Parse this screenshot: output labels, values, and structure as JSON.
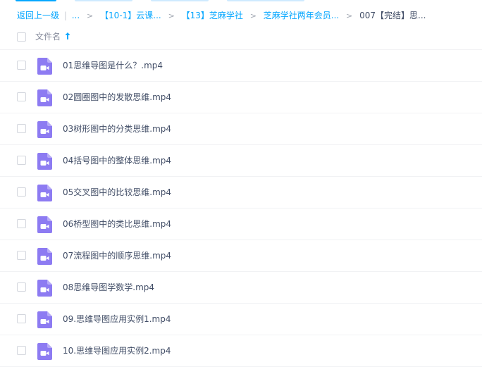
{
  "colors": {
    "accent": "#06a7ff",
    "video_icon": "#8d7bf2",
    "text": "#424e67",
    "muted": "#878c9c"
  },
  "breadcrumb": {
    "back": "返回上一级",
    "ellipsis": "...",
    "separator": "|",
    "chevron": ">",
    "items": [
      "【10-1】云课...",
      "【13】芝麻学社",
      "芝麻学社两年会员..."
    ],
    "current": "007【完结】思..."
  },
  "header": {
    "column_label": "文件名",
    "sort_icon": "arrow-up-icon"
  },
  "files": [
    {
      "name": "01思维导图是什么？.mp4",
      "icon": "video-file-icon"
    },
    {
      "name": "02圆圈图中的发散思维.mp4",
      "icon": "video-file-icon"
    },
    {
      "name": "03树形图中的分类思维.mp4",
      "icon": "video-file-icon"
    },
    {
      "name": "04括号图中的整体思维.mp4",
      "icon": "video-file-icon"
    },
    {
      "name": "05交叉图中的比较思维.mp4",
      "icon": "video-file-icon"
    },
    {
      "name": "06桥型图中的类比思维.mp4",
      "icon": "video-file-icon"
    },
    {
      "name": "07流程图中的顺序思维.mp4",
      "icon": "video-file-icon"
    },
    {
      "name": "08思维导图学数学.mp4",
      "icon": "video-file-icon"
    },
    {
      "name": "09.思维导图应用实例1.mp4",
      "icon": "video-file-icon"
    },
    {
      "name": "10.思维导图应用实例2.mp4",
      "icon": "video-file-icon"
    }
  ]
}
